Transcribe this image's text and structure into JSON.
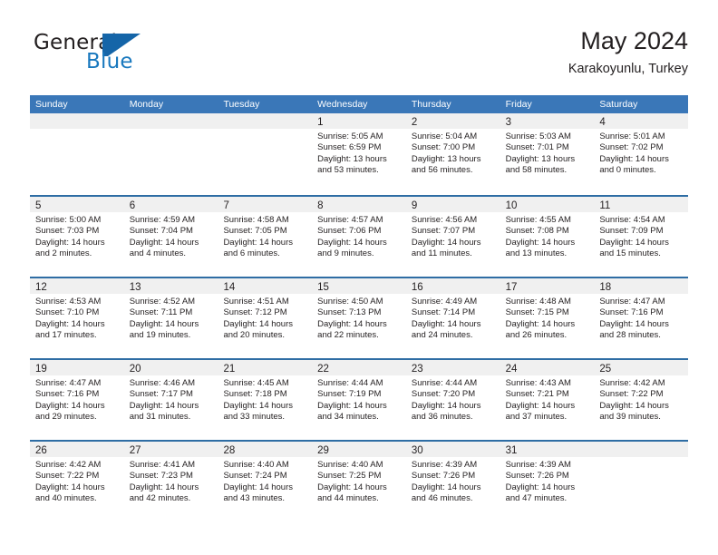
{
  "brand": {
    "word_one": "General",
    "word_two": "Blue",
    "mark": "flag-triangle-icon",
    "color_dark": "#231f20",
    "color_blue": "#1878be"
  },
  "header": {
    "title": "May 2024",
    "location": "Karakoyunlu, Turkey"
  },
  "theme": {
    "header_bg": "#3a77b8",
    "row_divider": "#2e6da4",
    "date_band_bg": "#f0f0f0",
    "text": "#231f20"
  },
  "weekdays": [
    "Sunday",
    "Monday",
    "Tuesday",
    "Wednesday",
    "Thursday",
    "Friday",
    "Saturday"
  ],
  "weeks": [
    [
      {
        "day": "",
        "empty": true,
        "sunrise": "",
        "sunset": "",
        "daylight_1": "",
        "daylight_2": ""
      },
      {
        "day": "",
        "empty": true,
        "sunrise": "",
        "sunset": "",
        "daylight_1": "",
        "daylight_2": ""
      },
      {
        "day": "",
        "empty": true,
        "sunrise": "",
        "sunset": "",
        "daylight_1": "",
        "daylight_2": ""
      },
      {
        "day": "1",
        "empty": false,
        "sunrise": "Sunrise: 5:05 AM",
        "sunset": "Sunset: 6:59 PM",
        "daylight_1": "Daylight: 13 hours",
        "daylight_2": "and 53 minutes."
      },
      {
        "day": "2",
        "empty": false,
        "sunrise": "Sunrise: 5:04 AM",
        "sunset": "Sunset: 7:00 PM",
        "daylight_1": "Daylight: 13 hours",
        "daylight_2": "and 56 minutes."
      },
      {
        "day": "3",
        "empty": false,
        "sunrise": "Sunrise: 5:03 AM",
        "sunset": "Sunset: 7:01 PM",
        "daylight_1": "Daylight: 13 hours",
        "daylight_2": "and 58 minutes."
      },
      {
        "day": "4",
        "empty": false,
        "sunrise": "Sunrise: 5:01 AM",
        "sunset": "Sunset: 7:02 PM",
        "daylight_1": "Daylight: 14 hours",
        "daylight_2": "and 0 minutes."
      }
    ],
    [
      {
        "day": "5",
        "empty": false,
        "sunrise": "Sunrise: 5:00 AM",
        "sunset": "Sunset: 7:03 PM",
        "daylight_1": "Daylight: 14 hours",
        "daylight_2": "and 2 minutes."
      },
      {
        "day": "6",
        "empty": false,
        "sunrise": "Sunrise: 4:59 AM",
        "sunset": "Sunset: 7:04 PM",
        "daylight_1": "Daylight: 14 hours",
        "daylight_2": "and 4 minutes."
      },
      {
        "day": "7",
        "empty": false,
        "sunrise": "Sunrise: 4:58 AM",
        "sunset": "Sunset: 7:05 PM",
        "daylight_1": "Daylight: 14 hours",
        "daylight_2": "and 6 minutes."
      },
      {
        "day": "8",
        "empty": false,
        "sunrise": "Sunrise: 4:57 AM",
        "sunset": "Sunset: 7:06 PM",
        "daylight_1": "Daylight: 14 hours",
        "daylight_2": "and 9 minutes."
      },
      {
        "day": "9",
        "empty": false,
        "sunrise": "Sunrise: 4:56 AM",
        "sunset": "Sunset: 7:07 PM",
        "daylight_1": "Daylight: 14 hours",
        "daylight_2": "and 11 minutes."
      },
      {
        "day": "10",
        "empty": false,
        "sunrise": "Sunrise: 4:55 AM",
        "sunset": "Sunset: 7:08 PM",
        "daylight_1": "Daylight: 14 hours",
        "daylight_2": "and 13 minutes."
      },
      {
        "day": "11",
        "empty": false,
        "sunrise": "Sunrise: 4:54 AM",
        "sunset": "Sunset: 7:09 PM",
        "daylight_1": "Daylight: 14 hours",
        "daylight_2": "and 15 minutes."
      }
    ],
    [
      {
        "day": "12",
        "empty": false,
        "sunrise": "Sunrise: 4:53 AM",
        "sunset": "Sunset: 7:10 PM",
        "daylight_1": "Daylight: 14 hours",
        "daylight_2": "and 17 minutes."
      },
      {
        "day": "13",
        "empty": false,
        "sunrise": "Sunrise: 4:52 AM",
        "sunset": "Sunset: 7:11 PM",
        "daylight_1": "Daylight: 14 hours",
        "daylight_2": "and 19 minutes."
      },
      {
        "day": "14",
        "empty": false,
        "sunrise": "Sunrise: 4:51 AM",
        "sunset": "Sunset: 7:12 PM",
        "daylight_1": "Daylight: 14 hours",
        "daylight_2": "and 20 minutes."
      },
      {
        "day": "15",
        "empty": false,
        "sunrise": "Sunrise: 4:50 AM",
        "sunset": "Sunset: 7:13 PM",
        "daylight_1": "Daylight: 14 hours",
        "daylight_2": "and 22 minutes."
      },
      {
        "day": "16",
        "empty": false,
        "sunrise": "Sunrise: 4:49 AM",
        "sunset": "Sunset: 7:14 PM",
        "daylight_1": "Daylight: 14 hours",
        "daylight_2": "and 24 minutes."
      },
      {
        "day": "17",
        "empty": false,
        "sunrise": "Sunrise: 4:48 AM",
        "sunset": "Sunset: 7:15 PM",
        "daylight_1": "Daylight: 14 hours",
        "daylight_2": "and 26 minutes."
      },
      {
        "day": "18",
        "empty": false,
        "sunrise": "Sunrise: 4:47 AM",
        "sunset": "Sunset: 7:16 PM",
        "daylight_1": "Daylight: 14 hours",
        "daylight_2": "and 28 minutes."
      }
    ],
    [
      {
        "day": "19",
        "empty": false,
        "sunrise": "Sunrise: 4:47 AM",
        "sunset": "Sunset: 7:16 PM",
        "daylight_1": "Daylight: 14 hours",
        "daylight_2": "and 29 minutes."
      },
      {
        "day": "20",
        "empty": false,
        "sunrise": "Sunrise: 4:46 AM",
        "sunset": "Sunset: 7:17 PM",
        "daylight_1": "Daylight: 14 hours",
        "daylight_2": "and 31 minutes."
      },
      {
        "day": "21",
        "empty": false,
        "sunrise": "Sunrise: 4:45 AM",
        "sunset": "Sunset: 7:18 PM",
        "daylight_1": "Daylight: 14 hours",
        "daylight_2": "and 33 minutes."
      },
      {
        "day": "22",
        "empty": false,
        "sunrise": "Sunrise: 4:44 AM",
        "sunset": "Sunset: 7:19 PM",
        "daylight_1": "Daylight: 14 hours",
        "daylight_2": "and 34 minutes."
      },
      {
        "day": "23",
        "empty": false,
        "sunrise": "Sunrise: 4:44 AM",
        "sunset": "Sunset: 7:20 PM",
        "daylight_1": "Daylight: 14 hours",
        "daylight_2": "and 36 minutes."
      },
      {
        "day": "24",
        "empty": false,
        "sunrise": "Sunrise: 4:43 AM",
        "sunset": "Sunset: 7:21 PM",
        "daylight_1": "Daylight: 14 hours",
        "daylight_2": "and 37 minutes."
      },
      {
        "day": "25",
        "empty": false,
        "sunrise": "Sunrise: 4:42 AM",
        "sunset": "Sunset: 7:22 PM",
        "daylight_1": "Daylight: 14 hours",
        "daylight_2": "and 39 minutes."
      }
    ],
    [
      {
        "day": "26",
        "empty": false,
        "sunrise": "Sunrise: 4:42 AM",
        "sunset": "Sunset: 7:22 PM",
        "daylight_1": "Daylight: 14 hours",
        "daylight_2": "and 40 minutes."
      },
      {
        "day": "27",
        "empty": false,
        "sunrise": "Sunrise: 4:41 AM",
        "sunset": "Sunset: 7:23 PM",
        "daylight_1": "Daylight: 14 hours",
        "daylight_2": "and 42 minutes."
      },
      {
        "day": "28",
        "empty": false,
        "sunrise": "Sunrise: 4:40 AM",
        "sunset": "Sunset: 7:24 PM",
        "daylight_1": "Daylight: 14 hours",
        "daylight_2": "and 43 minutes."
      },
      {
        "day": "29",
        "empty": false,
        "sunrise": "Sunrise: 4:40 AM",
        "sunset": "Sunset: 7:25 PM",
        "daylight_1": "Daylight: 14 hours",
        "daylight_2": "and 44 minutes."
      },
      {
        "day": "30",
        "empty": false,
        "sunrise": "Sunrise: 4:39 AM",
        "sunset": "Sunset: 7:26 PM",
        "daylight_1": "Daylight: 14 hours",
        "daylight_2": "and 46 minutes."
      },
      {
        "day": "31",
        "empty": false,
        "sunrise": "Sunrise: 4:39 AM",
        "sunset": "Sunset: 7:26 PM",
        "daylight_1": "Daylight: 14 hours",
        "daylight_2": "and 47 minutes."
      },
      {
        "day": "",
        "empty": true,
        "sunrise": "",
        "sunset": "",
        "daylight_1": "",
        "daylight_2": ""
      }
    ]
  ]
}
